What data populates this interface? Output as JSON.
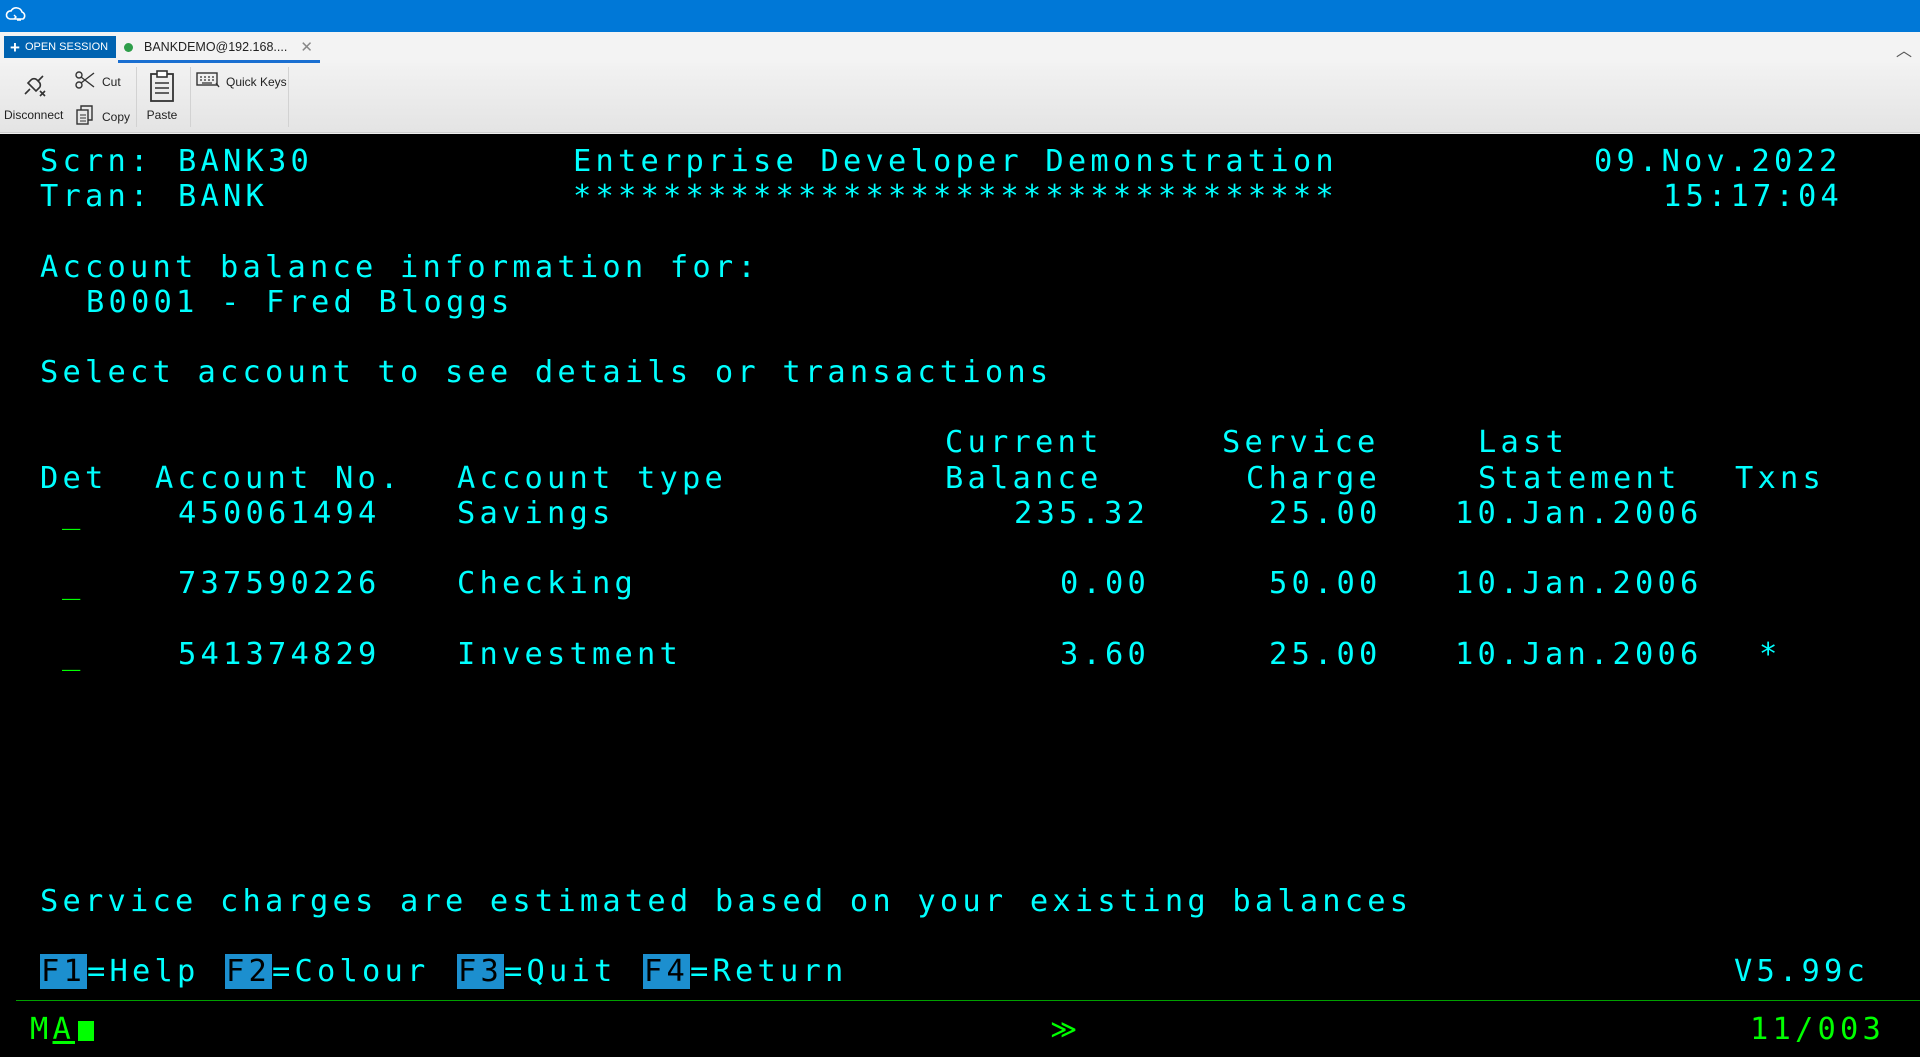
{
  "tabstrip": {
    "open_session_label": "OPEN SESSION",
    "session_tab_label": "BANKDEMO@192.168....",
    "session_status_color": "#2e9e4a"
  },
  "ribbon": {
    "disconnect_label": "Disconnect",
    "cut_label": "Cut",
    "copy_label": "Copy",
    "paste_label": "Paste",
    "quick_keys_label": "Quick Keys"
  },
  "screen": {
    "scrn_label": "Scrn:",
    "scrn_value": "BANK30",
    "tran_label": "Tran:",
    "tran_value": "BANK",
    "title": "Enterprise Developer Demonstration",
    "title_underline": "**********************************",
    "date": "09.Nov.2022",
    "time": "15:17:04",
    "info_heading": "Account balance information for:",
    "customer": "B0001 - Fred Bloggs",
    "instruction": "Select account to see details or transactions",
    "columns": {
      "det": "Det",
      "account_no": "Account No.",
      "account_type": "Account type",
      "current": "Current",
      "balance": "Balance",
      "service": "Service",
      "charge": "Charge",
      "last": "Last",
      "statement": "Statement",
      "txns": "Txns"
    },
    "accounts": [
      {
        "select": "_",
        "number": "450061494",
        "type": "Savings",
        "balance": "235.32",
        "charge": "25.00",
        "statement": "10.Jan.2006",
        "txns": ""
      },
      {
        "select": "_",
        "number": "737590226",
        "type": "Checking",
        "balance": "0.00",
        "charge": "50.00",
        "statement": "10.Jan.2006",
        "txns": ""
      },
      {
        "select": "_",
        "number": "541374829",
        "type": "Investment",
        "balance": "3.60",
        "charge": "25.00",
        "statement": "10.Jan.2006",
        "txns": "*"
      }
    ],
    "footer_message": "Service charges are estimated based on your existing balances",
    "fkeys": [
      {
        "key": "F1",
        "text": "=Help"
      },
      {
        "key": "F2",
        "text": "=Colour"
      },
      {
        "key": "F3",
        "text": "=Quit"
      },
      {
        "key": "F4",
        "text": "=Return"
      }
    ],
    "version": "V5.99c"
  },
  "status": {
    "mode_m": "M",
    "mode_a": "A",
    "indicator": "≫",
    "cursor_position": "11/003"
  }
}
